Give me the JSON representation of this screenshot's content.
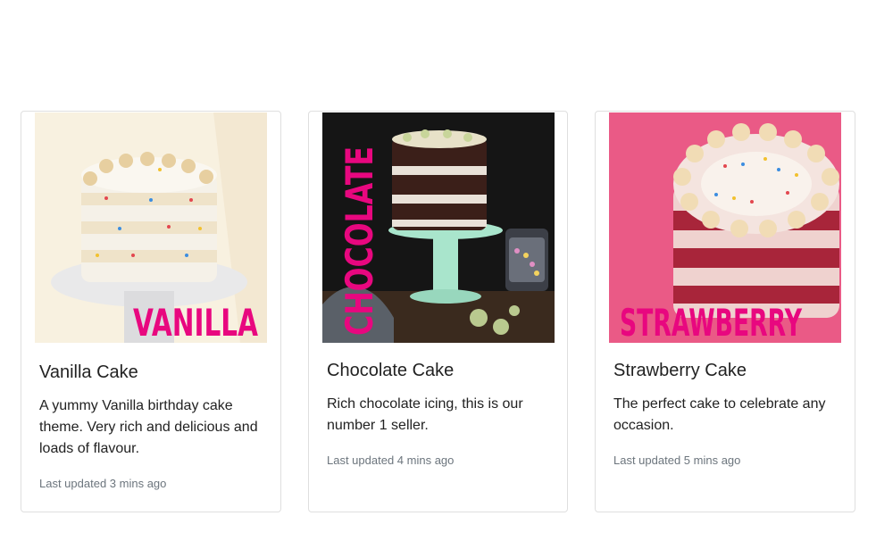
{
  "cards": [
    {
      "image_label": "VANILLA",
      "title": "Vanilla Cake",
      "text": "A yummy Vanilla birthday cake theme. Very rich and delicious and loads of flavour.",
      "updated": "Last updated 3 mins ago"
    },
    {
      "image_label": "CHOCOLATE",
      "title": "Chocolate Cake",
      "text": "Rich chocolate icing, this is our number 1 seller.",
      "updated": "Last updated 4 mins ago"
    },
    {
      "image_label": "STRAWBERRY",
      "title": "Strawberry Cake",
      "text": "The perfect cake to celebrate any occasion.",
      "updated": "Last updated 5 mins ago"
    }
  ],
  "colors": {
    "label_pink": "#e8077f",
    "border": "#dfdfdf",
    "muted_text": "#6c757d"
  }
}
